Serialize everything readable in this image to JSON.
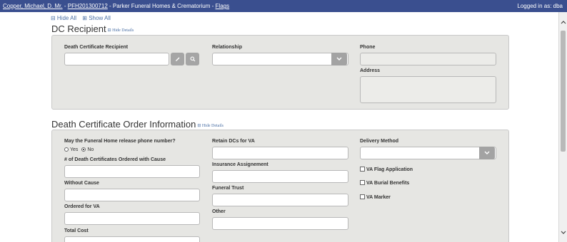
{
  "topbar": {
    "client_name": "Copper, Michael, D. Mr.",
    "sep1": "-",
    "case_id": "PFH201300712",
    "sep2": "-",
    "funeral_home": "Parker Funeral Homes & Crematorium",
    "sep3": "-",
    "flags": "Flags",
    "logged_in": "Logged in as: dba"
  },
  "toggles": {
    "hide_all": "⊟ Hide All",
    "show_all": "⊞ Show All"
  },
  "dc_recipient": {
    "title": "DC Recipient",
    "hide_details": "⊟ Hide Details",
    "recipient_label": "Death Certificate Recipient",
    "recipient_value": "",
    "relationship_label": "Relationship",
    "relationship_value": "",
    "phone_label": "Phone",
    "phone_value": "",
    "address_label": "Address",
    "address_value": ""
  },
  "order_info": {
    "title": "Death Certificate Order Information",
    "hide_details": "⊟ Hide Details",
    "release_phone_label": "May the Funeral Home release phone number?",
    "radio_yes": "Yes",
    "radio_no": "No",
    "radio_selected": "No",
    "with_cause_label": "# of Death Certificates Ordered with Cause",
    "without_cause_label": "Without Cause",
    "ordered_va_label": "Ordered for VA",
    "total_cost_label": "Total Cost",
    "retain_va_label": "Retain DCs for VA",
    "insurance_label": "Insurance Assignement",
    "funeral_trust_label": "Funeral Trust",
    "other_label": "Other",
    "delivery_label": "Delivery Method",
    "delivery_value": "",
    "va_flag": "VA Flag Application",
    "va_burial": "VA Burial Benefits",
    "va_marker": "VA Marker"
  },
  "icons": {
    "edit": "pencil-icon",
    "search": "search-icon",
    "dropdown": "chevron-down-icon"
  }
}
